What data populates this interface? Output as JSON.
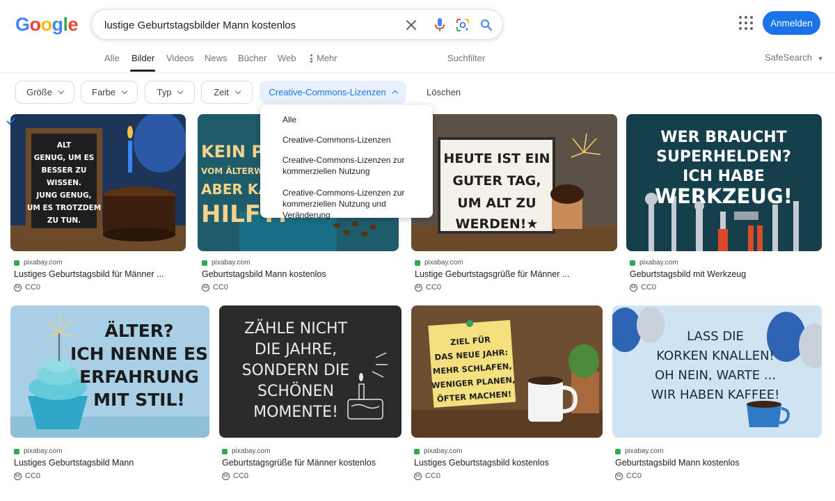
{
  "logo": "Google",
  "search": {
    "query": "lustige Geburtstagsbilder Mann kostenlos"
  },
  "header": {
    "signin_label": "Anmelden"
  },
  "tabs": [
    {
      "label": "Alle"
    },
    {
      "label": "Bilder",
      "active": true
    },
    {
      "label": "Videos"
    },
    {
      "label": "News"
    },
    {
      "label": "Bücher"
    },
    {
      "label": "Web"
    },
    {
      "label": "Mehr"
    }
  ],
  "tools_label": "Suchfilter",
  "safesearch_label": "SafeSearch",
  "chips": [
    {
      "label": "Größe"
    },
    {
      "label": "Farbe"
    },
    {
      "label": "Typ"
    },
    {
      "label": "Zeit"
    },
    {
      "label": "Creative-Commons-Lizenzen",
      "open": true
    }
  ],
  "clear_label": "Löschen",
  "license_menu": {
    "items": [
      {
        "label": "Alle",
        "checked": true
      },
      {
        "label": "Creative-Commons-Lizenzen"
      },
      {
        "label": "Creative-Commons-Lizenzen zur kommerziellen Nutzung"
      },
      {
        "label": "Creative-Commons-Lizenzen zur kommerziellen Nutzung und Veränderung"
      }
    ]
  },
  "results": [
    {
      "source": "pixabay.com",
      "title": "Lustiges Geburtstagsbild für Männer ...",
      "license": "CC0",
      "image_text": [
        "ALT",
        "GENUG, UM ES",
        "BESSER ZU",
        "WISSEN.",
        "JUNG GENUG,",
        "UM ES TROTZDEM",
        "ZU TUN."
      ]
    },
    {
      "source": "pixabay.com",
      "title": "Geburtstagsbild Mann kostenlos",
      "license": "CC0",
      "image_text": [
        "KEIN PLAN",
        "VOM ÄLTERWERDEN",
        "ABER KAFFEE",
        "HILFT!"
      ]
    },
    {
      "source": "pixabay.com",
      "title": "Lustige Geburtstagsgrüße für Männer ...",
      "license": "CC0",
      "image_text": [
        "HEUTE IST EIN",
        "GUTER TAG,",
        "UM ALT ZU",
        "WERDEN!★"
      ]
    },
    {
      "source": "pixabay.com",
      "title": "Geburtstagsbild mit Werkzeug",
      "license": "CC0",
      "image_text": [
        "WER BRAUCHT",
        "SUPERHELDEN?",
        "ICH HABE",
        "WERKZEUG!"
      ]
    },
    {
      "source": "pixabay.com",
      "title": "Lustiges Geburtstagsbild Mann",
      "license": "CC0",
      "image_text": [
        "ÄLTER?",
        "ICH NENNE ES",
        "ERFAHRUNG",
        "MIT STIL!"
      ]
    },
    {
      "source": "pixabay.com",
      "title": "Geburtstagsgrüße für Männer kostenlos",
      "license": "CC0",
      "image_text": [
        "ZÄHLE NICHT",
        "DIE JAHRE,",
        "SONDERN DIE",
        "SCHÖNEN",
        "MOMENTE!"
      ]
    },
    {
      "source": "pixabay.com",
      "title": "Lustiges Geburtstagsbild kostenlos",
      "license": "CC0",
      "image_text": [
        "ZIEL FÜR",
        "DAS NEUE JAHR:",
        "MEHR SCHLAFEN,",
        "WENIGER PLANEN,",
        "ÖFTER MACHEN!"
      ]
    },
    {
      "source": "pixabay.com",
      "title": "Geburtstagsbild Mann kostenlos",
      "license": "CC0",
      "image_text": [
        "LASS DIE",
        "KORKEN KNALLEN!",
        "OH NEIN, WARTE ...",
        "WIR HABEN KAFFEE!"
      ]
    }
  ]
}
